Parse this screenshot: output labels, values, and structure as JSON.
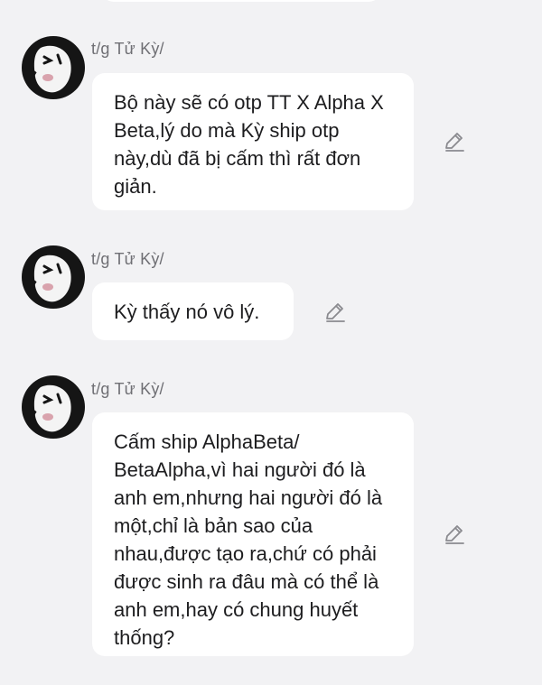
{
  "messages": [
    {
      "author": "t/g Tử Kỳ/",
      "text": "Bộ này sẽ có otp TT X Alpha X Beta,lý do mà Kỳ ship otp này,dù đã bị cấm thì rất đơn giản."
    },
    {
      "author": "t/g Tử Kỳ/",
      "text": "Kỳ thấy nó vô lý."
    },
    {
      "author": "t/g Tử Kỳ/",
      "text": "Cấm ship AlphaBeta/ BetaAlpha,vì hai người đó là anh em,nhưng hai người đó là một,chỉ là bản sao của nhau,được tạo ra,chứ có phải được sinh ra đâu mà có thể là anh em,hay có chung huyết thống?"
    }
  ],
  "icons": {
    "avatar": "ghost-face-avatar-icon",
    "edit": "pencil-edit-icon"
  },
  "colors": {
    "background": "#f2f2f4",
    "bubble": "#ffffff",
    "author_text": "#6f6f74",
    "message_text": "#1d1d1f",
    "icon": "#8a8a8f"
  }
}
